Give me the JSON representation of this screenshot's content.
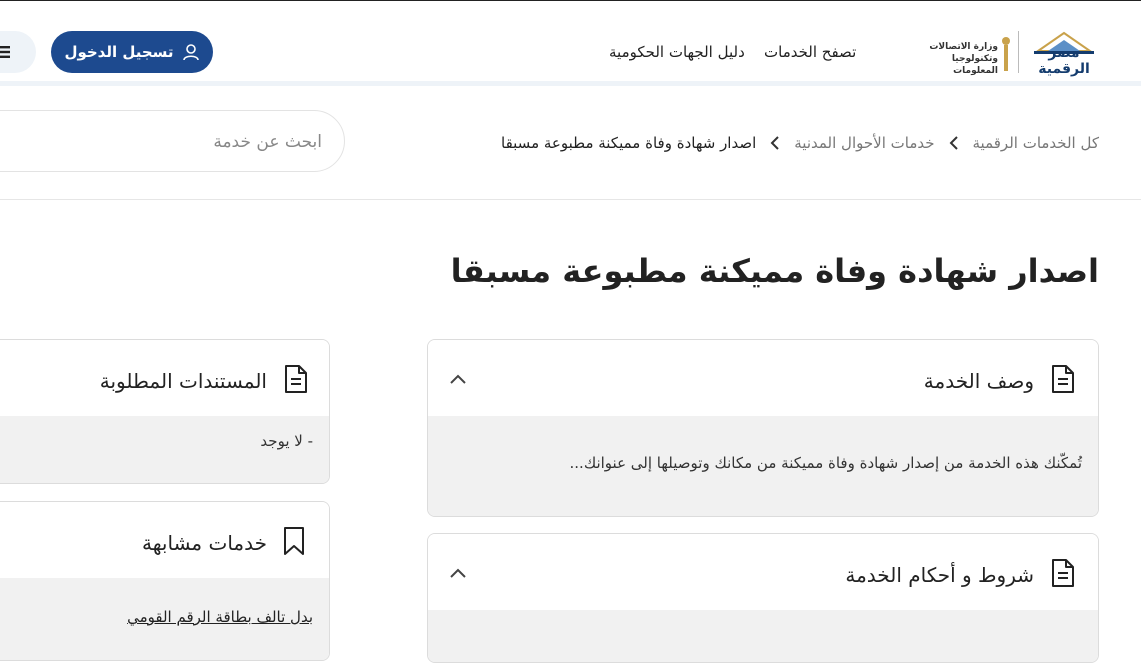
{
  "header": {
    "logo_title": "مصر الرقمية",
    "ministry_name_line1": "وزارة الاتصالات",
    "ministry_name_line2": "وتكنولوجيا المعلومات",
    "nav": [
      {
        "label": "تصفح الخدمات"
      },
      {
        "label": "دليل الجهات الحكومية"
      }
    ],
    "login_label": "تسجيل الدخول",
    "accent_color": "#1d4a8f"
  },
  "breadcrumb": {
    "items": [
      "كل الخدمات الرقمية",
      "خدمات الأحوال المدنية",
      "اصدار شهادة وفاة مميكنة مطبوعة مسبقا"
    ]
  },
  "search": {
    "placeholder": "ابحث عن خدمة",
    "value": ""
  },
  "page": {
    "title": "اصدار شهادة وفاة مميكنة مطبوعة مسبقا"
  },
  "cards": {
    "description": {
      "title": "وصف الخدمة",
      "text": "تُمكّنك هذه الخدمة من إصدار شهادة وفاة مميكنة من مكانك وتوصيلها إلى عنوانك..."
    },
    "terms": {
      "title": "شروط و أحكام الخدمة"
    },
    "documents": {
      "title": "المستندات المطلوبة",
      "text": "- لا يوجد"
    },
    "related": {
      "title": "خدمات مشابهة",
      "items": [
        "بدل تالف بطاقة الرقم القومي"
      ]
    }
  },
  "icons": {
    "document": "document-icon",
    "bookmark": "bookmark-icon",
    "user": "user-icon",
    "menu": "menu-icon",
    "chevron": "chevron-left-icon",
    "collapse": "chevron-up-icon"
  }
}
